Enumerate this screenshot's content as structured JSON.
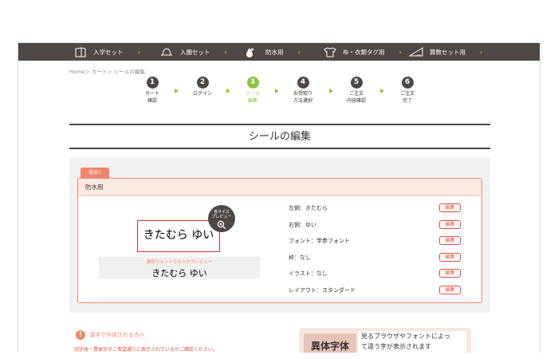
{
  "nav": {
    "items": [
      {
        "label": "入学セット",
        "icon": "notebook-icon"
      },
      {
        "label": "入園セット",
        "icon": "hat-icon"
      },
      {
        "label": "防水用",
        "icon": "water-drop-icon"
      },
      {
        "label": "布・衣類タグ用",
        "icon": "tshirt-icon"
      },
      {
        "label": "算数セット用",
        "icon": "ruler-icon"
      }
    ],
    "chevron": "›"
  },
  "breadcrumb": "Home＞ カート＞ シールの編集",
  "steps": [
    {
      "num": "1",
      "line1": "カート",
      "line2": "確認"
    },
    {
      "num": "2",
      "line1": "ログイン",
      "line2": ""
    },
    {
      "num": "3",
      "line1": "シール",
      "line2": "編集"
    },
    {
      "num": "4",
      "line1": "お受取り",
      "line2": "方法選択"
    },
    {
      "num": "5",
      "line1": "ご注文",
      "line2": "内容確認"
    },
    {
      "num": "6",
      "line1": "ご注文",
      "line2": "完了"
    }
  ],
  "page_title": "シールの編集",
  "product": {
    "tab_label": "商品1",
    "header": "防水用",
    "sticker_text": "きたむら ゆい",
    "zoom_label_1": "各サイズ",
    "zoom_label_2": "プレビュー",
    "preview_label": "選択フォントでの入力プレビュー",
    "preview_text": "きたむら ゆい",
    "attributes": [
      "左側：きたむら",
      "右側：ゆい",
      "フォント：学参フォント",
      "枠：なし",
      "イラスト：なし",
      "レイアウト：スタンダード"
    ],
    "edit_label": "編集"
  },
  "notice": {
    "icon": "!",
    "title": "漢字で作成される方へ",
    "text": "旧字体・異体字がご希望通りに表示されているかご確認ください。"
  },
  "font_box": {
    "sample": "異体字体",
    "desc_line1": "見るブラウザやフォントによっ",
    "desc_line2": "て違う字が表示されます"
  },
  "colors": {
    "nav_bg": "#4d4845",
    "accent_green": "#8cc63f",
    "accent_orange": "#f0856b",
    "edit_red": "#e74c3c"
  }
}
